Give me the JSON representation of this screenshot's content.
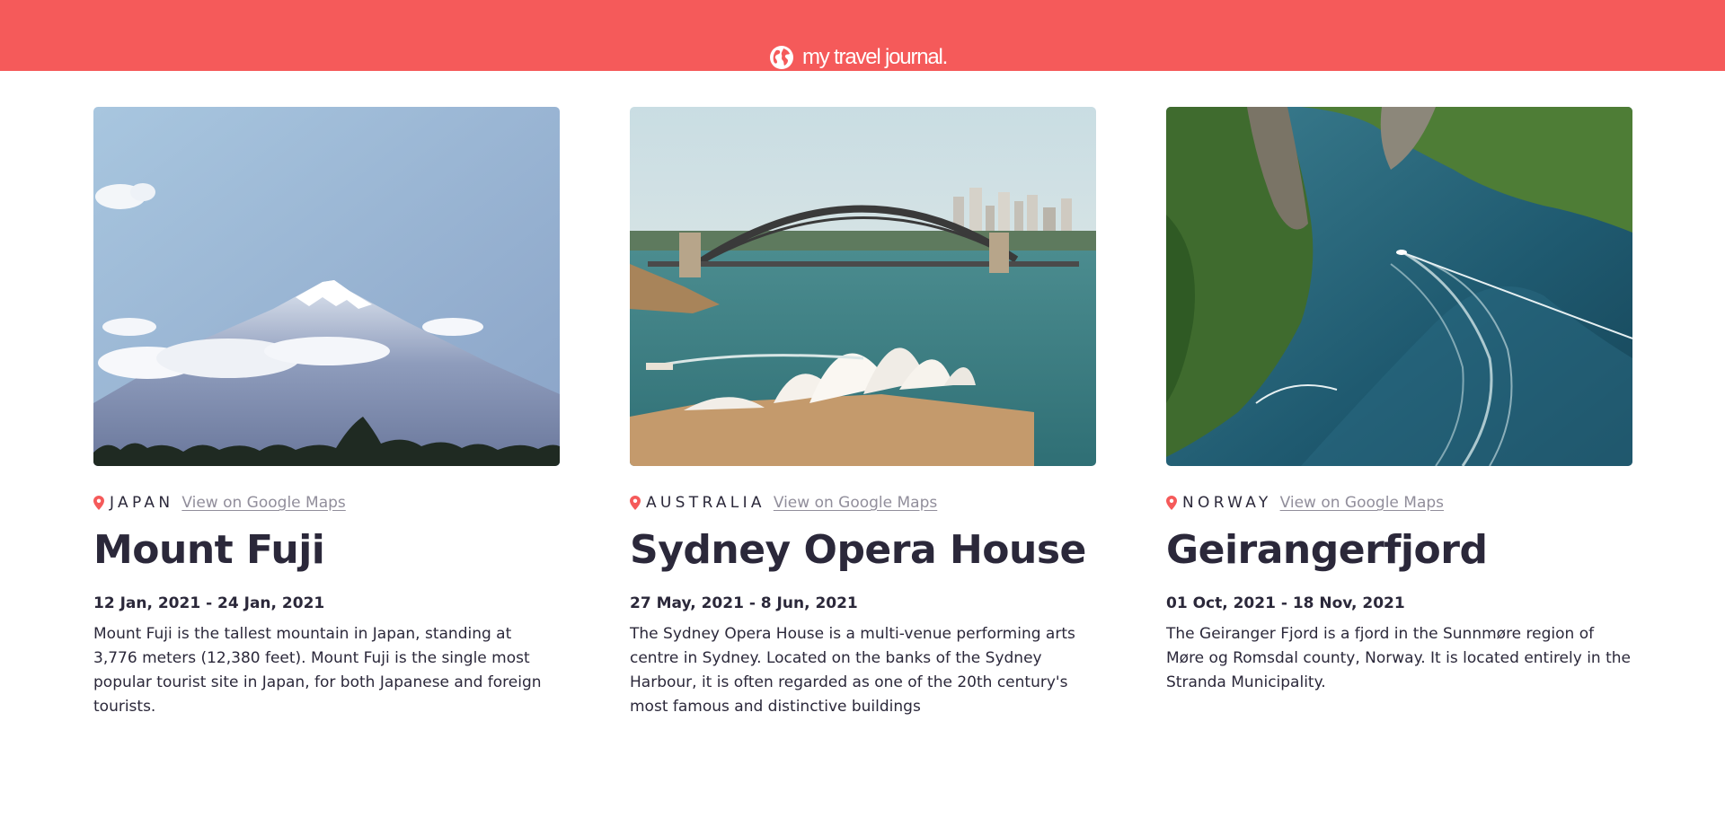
{
  "header": {
    "brand_text": "my travel journal.",
    "icon": "globe-icon",
    "background_color": "#f55a5a"
  },
  "entries": [
    {
      "country": "JAPAN",
      "maps_link_text": "View on Google Maps",
      "title": "Mount Fuji",
      "dates": "12 Jan, 2021 - 24 Jan, 2021",
      "description": "Mount Fuji is the tallest mountain in Japan, standing at 3,776 meters (12,380 feet). Mount Fuji is the single most popular tourist site in Japan, for both Japanese and foreign tourists.",
      "image": "mount-fuji-photo"
    },
    {
      "country": "AUSTRALIA",
      "maps_link_text": "View on Google Maps",
      "title": "Sydney Opera House",
      "dates": "27 May, 2021 - 8 Jun, 2021",
      "description": "The Sydney Opera House is a multi-venue performing arts centre in Sydney. Located on the banks of the Sydney Harbour, it is often regarded as one of the 20th century's most famous and distinctive buildings",
      "image": "sydney-opera-house-photo"
    },
    {
      "country": "NORWAY",
      "maps_link_text": "View on Google Maps",
      "title": "Geirangerfjord",
      "dates": "01 Oct, 2021 - 18 Nov, 2021",
      "description": "The Geiranger Fjord is a fjord in the Sunnmøre region of Møre og Romsdal county, Norway. It is located entirely in the Stranda Municipality.",
      "image": "geirangerfjord-photo"
    }
  ],
  "colors": {
    "accent": "#f55a5a",
    "text": "#2b283a",
    "link": "#918e9b"
  }
}
